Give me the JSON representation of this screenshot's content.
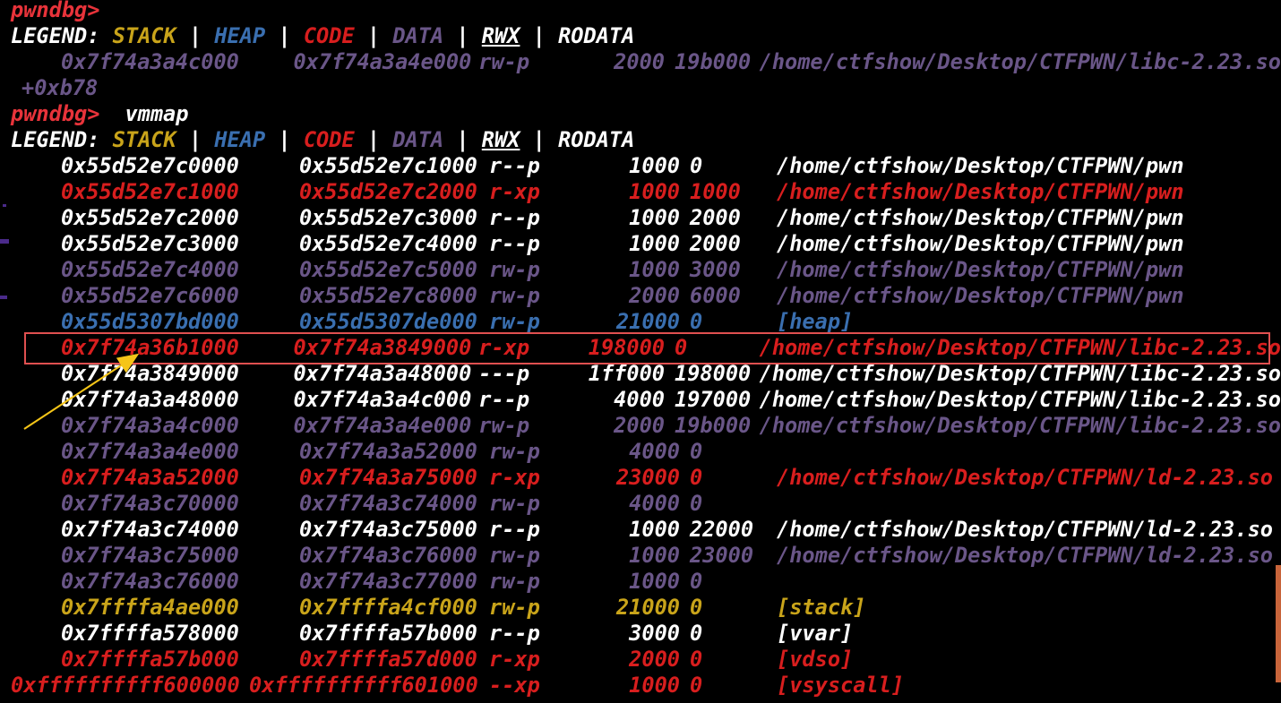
{
  "prompt": "pwndbg>",
  "legend": {
    "label": "LEGEND:",
    "items": [
      {
        "text": "STACK",
        "color": "#c9a41a"
      },
      {
        "text": "HEAP",
        "color": "#3a6fb0"
      },
      {
        "text": "CODE",
        "color": "#d81e1e"
      },
      {
        "text": "DATA",
        "color": "#6a5688"
      },
      {
        "text": "RWX",
        "color": "#ffffff"
      },
      {
        "text": "RODATA",
        "color": "#ffffff"
      }
    ],
    "separator": "|"
  },
  "first_block": {
    "row": {
      "start": "0x7f74a3a4c000",
      "end": "0x7f74a3a4e000",
      "perm": "rw-p",
      "size": "2000",
      "offset": "19b000",
      "path": "/home/ctfshow/Desktop/CTFPWN/libc-2.23.so",
      "color": "#6a5688"
    },
    "continuation": "+0xb78"
  },
  "command": "vmmap",
  "rows": [
    {
      "start": "0x55d52e7c0000",
      "end": "0x55d52e7c1000",
      "perm": "r--p",
      "size": "1000",
      "offset": "0",
      "path": "/home/ctfshow/Desktop/CTFPWN/pwn",
      "color": "#ffffff"
    },
    {
      "start": "0x55d52e7c1000",
      "end": "0x55d52e7c2000",
      "perm": "r-xp",
      "size": "1000",
      "offset": "1000",
      "path": "/home/ctfshow/Desktop/CTFPWN/pwn",
      "color": "#d81e1e"
    },
    {
      "start": "0x55d52e7c2000",
      "end": "0x55d52e7c3000",
      "perm": "r--p",
      "size": "1000",
      "offset": "2000",
      "path": "/home/ctfshow/Desktop/CTFPWN/pwn",
      "color": "#ffffff"
    },
    {
      "start": "0x55d52e7c3000",
      "end": "0x55d52e7c4000",
      "perm": "r--p",
      "size": "1000",
      "offset": "2000",
      "path": "/home/ctfshow/Desktop/CTFPWN/pwn",
      "color": "#ffffff"
    },
    {
      "start": "0x55d52e7c4000",
      "end": "0x55d52e7c5000",
      "perm": "rw-p",
      "size": "1000",
      "offset": "3000",
      "path": "/home/ctfshow/Desktop/CTFPWN/pwn",
      "color": "#6a5688"
    },
    {
      "start": "0x55d52e7c6000",
      "end": "0x55d52e7c8000",
      "perm": "rw-p",
      "size": "2000",
      "offset": "6000",
      "path": "/home/ctfshow/Desktop/CTFPWN/pwn",
      "color": "#6a5688"
    },
    {
      "start": "0x55d5307bd000",
      "end": "0x55d5307de000",
      "perm": "rw-p",
      "size": "21000",
      "offset": "0",
      "path": "[heap]",
      "color": "#3a6fb0"
    },
    {
      "start": "0x7f74a36b1000",
      "end": "0x7f74a3849000",
      "perm": "r-xp",
      "size": "198000",
      "offset": "0",
      "path": "/home/ctfshow/Desktop/CTFPWN/libc-2.23.so",
      "color": "#d81e1e"
    },
    {
      "start": "0x7f74a3849000",
      "end": "0x7f74a3a48000",
      "perm": "---p",
      "size": "1ff000",
      "offset": "198000",
      "path": "/home/ctfshow/Desktop/CTFPWN/libc-2.23.so",
      "color": "#ffffff"
    },
    {
      "start": "0x7f74a3a48000",
      "end": "0x7f74a3a4c000",
      "perm": "r--p",
      "size": "4000",
      "offset": "197000",
      "path": "/home/ctfshow/Desktop/CTFPWN/libc-2.23.so",
      "color": "#ffffff"
    },
    {
      "start": "0x7f74a3a4c000",
      "end": "0x7f74a3a4e000",
      "perm": "rw-p",
      "size": "2000",
      "offset": "19b000",
      "path": "/home/ctfshow/Desktop/CTFPWN/libc-2.23.so",
      "color": "#6a5688"
    },
    {
      "start": "0x7f74a3a4e000",
      "end": "0x7f74a3a52000",
      "perm": "rw-p",
      "size": "4000",
      "offset": "0",
      "path": "",
      "color": "#6a5688"
    },
    {
      "start": "0x7f74a3a52000",
      "end": "0x7f74a3a75000",
      "perm": "r-xp",
      "size": "23000",
      "offset": "0",
      "path": "/home/ctfshow/Desktop/CTFPWN/ld-2.23.so",
      "color": "#d81e1e"
    },
    {
      "start": "0x7f74a3c70000",
      "end": "0x7f74a3c74000",
      "perm": "rw-p",
      "size": "4000",
      "offset": "0",
      "path": "",
      "color": "#6a5688"
    },
    {
      "start": "0x7f74a3c74000",
      "end": "0x7f74a3c75000",
      "perm": "r--p",
      "size": "1000",
      "offset": "22000",
      "path": "/home/ctfshow/Desktop/CTFPWN/ld-2.23.so",
      "color": "#ffffff"
    },
    {
      "start": "0x7f74a3c75000",
      "end": "0x7f74a3c76000",
      "perm": "rw-p",
      "size": "1000",
      "offset": "23000",
      "path": "/home/ctfshow/Desktop/CTFPWN/ld-2.23.so",
      "color": "#6a5688"
    },
    {
      "start": "0x7f74a3c76000",
      "end": "0x7f74a3c77000",
      "perm": "rw-p",
      "size": "1000",
      "offset": "0",
      "path": "",
      "color": "#6a5688"
    },
    {
      "start": "0x7ffffa4ae000",
      "end": "0x7ffffa4cf000",
      "perm": "rw-p",
      "size": "21000",
      "offset": "0",
      "path": "[stack]",
      "color": "#c9a41a"
    },
    {
      "start": "0x7ffffa578000",
      "end": "0x7ffffa57b000",
      "perm": "r--p",
      "size": "3000",
      "offset": "0",
      "path": "[vvar]",
      "color": "#ffffff"
    },
    {
      "start": "0x7ffffa57b000",
      "end": "0x7ffffa57d000",
      "perm": "r-xp",
      "size": "2000",
      "offset": "0",
      "path": "[vdso]",
      "color": "#d81e1e"
    },
    {
      "start": "0xffffffffff600000",
      "end": "0xffffffffff601000",
      "perm": "--xp",
      "size": "1000",
      "offset": "0",
      "path": "[vsyscall]",
      "color": "#d81e1e"
    }
  ],
  "annotation": {
    "highlight_color": "#e05050",
    "arrow_color": "#f5c518"
  }
}
